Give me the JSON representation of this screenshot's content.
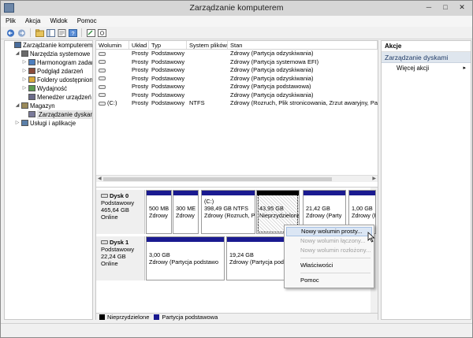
{
  "window": {
    "title": "Zarządzanie komputerem",
    "controls": {
      "minimize": "─",
      "maximize": "□",
      "close": "✕"
    }
  },
  "menu": [
    "Plik",
    "Akcja",
    "Widok",
    "Pomoc"
  ],
  "toolbar_icons": [
    "back-arrow-icon",
    "forward-arrow-icon",
    "folder-up-icon",
    "console-tree-icon",
    "properties-icon",
    "help-icon",
    "wizard-icon",
    "settings-icon"
  ],
  "tree": [
    {
      "label": "Zarządzanie komputerem (loka",
      "indent": 0,
      "exp": "",
      "icon": "computer-icon"
    },
    {
      "label": "Narzędzia systemowe",
      "indent": 1,
      "exp": "◢",
      "icon": "tools-icon"
    },
    {
      "label": "Harmonogram zadań",
      "indent": 2,
      "exp": "▷",
      "icon": "clock-icon"
    },
    {
      "label": "Podgląd zdarzeń",
      "indent": 2,
      "exp": "▷",
      "icon": "event-viewer-icon"
    },
    {
      "label": "Foldery udostępnione",
      "indent": 2,
      "exp": "▷",
      "icon": "shared-folder-icon"
    },
    {
      "label": "Wydajność",
      "indent": 2,
      "exp": "▷",
      "icon": "performance-icon"
    },
    {
      "label": "Menedżer urządzeń",
      "indent": 2,
      "exp": "",
      "icon": "device-manager-icon"
    },
    {
      "label": "Magazyn",
      "indent": 1,
      "exp": "◢",
      "icon": "storage-icon"
    },
    {
      "label": "Zarządzanie dyskami",
      "indent": 2,
      "exp": "",
      "icon": "disk-management-icon",
      "selected": true
    },
    {
      "label": "Usługi i aplikacje",
      "indent": 1,
      "exp": "▷",
      "icon": "services-icon"
    }
  ],
  "volumes": {
    "headers": [
      "Wolumin",
      "Układ",
      "Typ",
      "System plików",
      "Stan"
    ],
    "rows": [
      [
        "",
        "Prosty",
        "Podstawowy",
        "",
        "Zdrowy (Partycja odzyskiwania)"
      ],
      [
        "",
        "Prosty",
        "Podstawowy",
        "",
        "Zdrowy (Partycja systemowa EFI)"
      ],
      [
        "",
        "Prosty",
        "Podstawowy",
        "",
        "Zdrowy (Partycja odzyskiwania)"
      ],
      [
        "",
        "Prosty",
        "Podstawowy",
        "",
        "Zdrowy (Partycja odzyskiwania)"
      ],
      [
        "",
        "Prosty",
        "Podstawowy",
        "",
        "Zdrowy (Partycja podstawowa)"
      ],
      [
        "",
        "Prosty",
        "Podstawowy",
        "",
        "Zdrowy (Partycja odzyskiwania)"
      ],
      [
        "(C:)",
        "Prosty",
        "Podstawowy",
        "NTFS",
        "Zdrowy (Rozruch, Plik stronicowania, Zrzut awaryjny, Partycja"
      ]
    ]
  },
  "disks": [
    {
      "name": "Dysk 0",
      "type": "Podstawowy",
      "size": "465,64 GB",
      "status": "Online",
      "partitions": [
        {
          "line1": "",
          "line2": "500 MB",
          "line3": "Zdrowy",
          "kind": "primary"
        },
        {
          "line1": "",
          "line2": "300 ME",
          "line3": "Zdrowy",
          "kind": "primary"
        },
        {
          "line1": "(C:)",
          "line2": "398,49 GB NTFS",
          "line3": "Zdrowy (Rozruch, P",
          "kind": "primary"
        },
        {
          "line1": "",
          "line2": "43,95 GB",
          "line3": "Nieprzydzielone",
          "kind": "unalloc"
        },
        {
          "line1": "",
          "line2": "21,42 GB",
          "line3": "Zdrowy (Party",
          "kind": "primary"
        },
        {
          "line1": "",
          "line2": "1,00 GB",
          "line3": "Zdrowy (F",
          "kind": "primary"
        }
      ]
    },
    {
      "name": "Dysk 1",
      "type": "Podstawowy",
      "size": "22,24 GB",
      "status": "Online",
      "partitions": [
        {
          "line1": "",
          "line2": "3,00 GB",
          "line3": "Zdrowy (Partycja podstawo",
          "kind": "primary"
        },
        {
          "line1": "",
          "line2": "19,24 GB",
          "line3": "Zdrowy (Partycja podstawo",
          "kind": "primary"
        }
      ]
    }
  ],
  "legend": [
    {
      "label": "Nieprzydzielone",
      "color": "#000000"
    },
    {
      "label": "Partycja podstawowa",
      "color": "#1a1a90"
    }
  ],
  "actions": {
    "header": "Akcje",
    "section": "Zarządzanie dyskami",
    "items": [
      {
        "label": "Więcej akcji",
        "arrow": "▸"
      }
    ],
    "section_arrow": "▴"
  },
  "context_menu": {
    "items": [
      {
        "label": "Nowy wolumin prosty...",
        "enabled": true,
        "highlighted": true
      },
      {
        "label": "Nowy wolumin łączony...",
        "enabled": false
      },
      {
        "label": "Nowy wolumin rozłożony...",
        "enabled": false
      },
      {
        "sep": true
      },
      {
        "label": "Właściwości",
        "enabled": true
      },
      {
        "sep": true
      },
      {
        "label": "Pomoc",
        "enabled": true
      }
    ]
  }
}
